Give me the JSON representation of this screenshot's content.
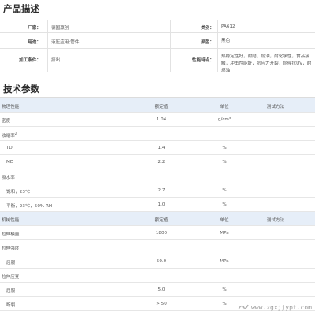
{
  "sections": {
    "description_title": "产品描述",
    "tech_title": "技术参数"
  },
  "description": {
    "rows": [
      {
        "label1": "厂家：",
        "value1": "德国赢创",
        "label2": "类别：",
        "value2": "PA612"
      },
      {
        "label1": "用途：",
        "value1": "液压应用;管件",
        "label2": "颜色：",
        "value2": "黑色"
      },
      {
        "label1": "加工条件：",
        "value1": "挤出",
        "label2": "性能特点：",
        "value2": "热稳定性好，耐磨，耐油，耐化学性，食品接触，冲击性能好，抗应力开裂，耐候抗UV，耐燃油"
      }
    ]
  },
  "tech": {
    "header1": {
      "c0": "物理性能",
      "c1": "额定值",
      "c2": "单位",
      "c3": "测试方法"
    },
    "rows1": [
      {
        "c0": "密度",
        "c1": "1.04",
        "c2": "g/cm³",
        "c3": "",
        "indent": false
      },
      {
        "c0": "收缩率",
        "sup": "2",
        "c1": "",
        "c2": "",
        "c3": "",
        "indent": false
      },
      {
        "c0": "TD",
        "c1": "1.4",
        "c2": "%",
        "c3": "",
        "indent": true
      },
      {
        "c0": "MD",
        "c1": "2.2",
        "c2": "%",
        "c3": "",
        "indent": true
      },
      {
        "c0": "吸水率",
        "c1": "",
        "c2": "",
        "c3": "",
        "indent": false
      },
      {
        "c0": "饱和，23℃",
        "c1": "2.7",
        "c2": "%",
        "c3": "",
        "indent": true
      },
      {
        "c0": "平衡，23℃，50% RH",
        "c1": "1.0",
        "c2": "%",
        "c3": "",
        "indent": true
      }
    ],
    "header2": {
      "c0": "机械性能",
      "c1": "额定值",
      "c2": "单位",
      "c3": "测试方法"
    },
    "rows2": [
      {
        "c0": "拉伸模量",
        "c1": "1800",
        "c2": "MPa",
        "c3": "",
        "indent": false
      },
      {
        "c0": "拉伸强度",
        "c1": "",
        "c2": "",
        "c3": "",
        "indent": false
      },
      {
        "c0": "屈服",
        "c1": "50.0",
        "c2": "MPa",
        "c3": "",
        "indent": true
      },
      {
        "c0": "拉伸应变",
        "c1": "",
        "c2": "",
        "c3": "",
        "indent": false
      },
      {
        "c0": "屈服",
        "c1": "5.0",
        "c2": "%",
        "c3": "",
        "indent": true
      },
      {
        "c0": "断裂",
        "c1": "> 50",
        "c2": "%",
        "c3": "",
        "indent": true
      }
    ]
  },
  "watermark": {
    "text": "www.zgxjjypt.com",
    "icon": "logo-icon"
  }
}
